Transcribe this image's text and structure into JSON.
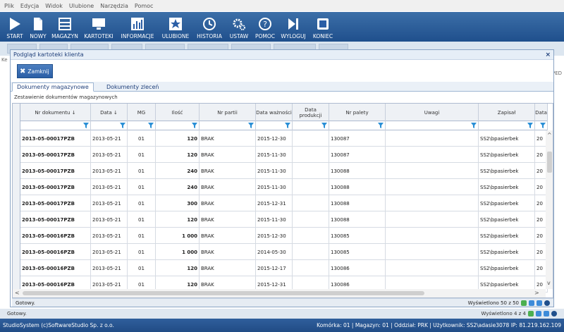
{
  "menu": [
    "Plik",
    "Edycja",
    "Widok",
    "Ulubione",
    "Narzędzia",
    "Pomoc"
  ],
  "toolbar": [
    {
      "label": "START",
      "icon": "play-icon"
    },
    {
      "label": "NOWY",
      "icon": "document-icon"
    },
    {
      "label": "MAGAZYN",
      "icon": "warehouse-icon"
    },
    {
      "label": "KARTOTEKI",
      "icon": "monitor-icon"
    },
    {
      "label": "INFORMACJE",
      "icon": "chart-icon"
    },
    {
      "label": "ULUBIONE",
      "icon": "star-icon"
    },
    {
      "label": "HISTORIA",
      "icon": "history-icon"
    },
    {
      "label": "USTAW",
      "icon": "gears-icon"
    },
    {
      "label": "POMOC",
      "icon": "help-icon"
    },
    {
      "label": "WYLOGUJ",
      "icon": "logout-icon"
    },
    {
      "label": "KONIEC",
      "icon": "window-icon"
    }
  ],
  "behind": {
    "left_label": "Ke",
    "right_label": "PED"
  },
  "dialog": {
    "title": "Podgląd kartoteki klienta",
    "close_x": "×",
    "close_button": "Zamknij",
    "tabs": [
      "Dokumenty magazynowe",
      "Dokumenty zleceń"
    ],
    "active_tab": 0,
    "section_title": "Zestawienie dokumentów magazynowych"
  },
  "grid": {
    "columns": [
      {
        "label": "Nr dokumentu ↓"
      },
      {
        "label": "Data ↓"
      },
      {
        "label": "MG"
      },
      {
        "label": "Ilość"
      },
      {
        "label": "Nr partii"
      },
      {
        "label": "Data ważności"
      },
      {
        "label": "Data produkcji"
      },
      {
        "label": "Nr palety"
      },
      {
        "label": "Uwagi"
      },
      {
        "label": "Zapisał"
      },
      {
        "label": "Data"
      }
    ],
    "rows": [
      [
        "2013-05-00017PZB",
        "2013-05-21",
        "01",
        "120",
        "BRAK",
        "2015-12-30",
        "",
        "130087",
        "",
        "SS2\\bpasierbek",
        "20"
      ],
      [
        "2013-05-00017PZB",
        "2013-05-21",
        "01",
        "120",
        "BRAK",
        "2015-11-30",
        "",
        "130087",
        "",
        "SS2\\bpasierbek",
        "20"
      ],
      [
        "2013-05-00017PZB",
        "2013-05-21",
        "01",
        "240",
        "BRAK",
        "2015-11-30",
        "",
        "130088",
        "",
        "SS2\\bpasierbek",
        "20"
      ],
      [
        "2013-05-00017PZB",
        "2013-05-21",
        "01",
        "240",
        "BRAK",
        "2015-11-30",
        "",
        "130088",
        "",
        "SS2\\bpasierbek",
        "20"
      ],
      [
        "2013-05-00017PZB",
        "2013-05-21",
        "01",
        "300",
        "BRAK",
        "2015-12-31",
        "",
        "130088",
        "",
        "SS2\\bpasierbek",
        "20"
      ],
      [
        "2013-05-00017PZB",
        "2013-05-21",
        "01",
        "120",
        "BRAK",
        "2015-11-30",
        "",
        "130088",
        "",
        "SS2\\bpasierbek",
        "20"
      ],
      [
        "2013-05-00016PZB",
        "2013-05-21",
        "01",
        "1 000",
        "BRAK",
        "2015-12-30",
        "",
        "130085",
        "",
        "SS2\\bpasierbek",
        "20"
      ],
      [
        "2013-05-00016PZB",
        "2013-05-21",
        "01",
        "1 000",
        "BRAK",
        "2014-05-30",
        "",
        "130085",
        "",
        "SS2\\bpasierbek",
        "20"
      ],
      [
        "2013-05-00016PZB",
        "2013-05-21",
        "01",
        "120",
        "BRAK",
        "2015-12-17",
        "",
        "130086",
        "",
        "SS2\\bpasierbek",
        "20"
      ],
      [
        "2013-05-00016PZB",
        "2013-05-21",
        "01",
        "120",
        "BRAK",
        "2015-12-31",
        "",
        "130086",
        "",
        "SS2\\bpasierbek",
        "20"
      ]
    ]
  },
  "status_inner": {
    "left": "Gotowy.",
    "right": "Wyświetlono 50 z 50"
  },
  "status_outer": {
    "left": "Gotowy.",
    "right": "Wyświetlono 4 z 4"
  },
  "footer": {
    "left": "StudioSystem (c)SoftwareStudio Sp. z o.o.",
    "right": "Komórka: 01 | Magazyn: 01 | Oddział: PRK | Użytkownik: SS2\\adasie3078 IP: 81.219.162.109"
  },
  "colors": {
    "toolbar": "#2a5ea6",
    "accent": "#1f3f7a",
    "filter": "#2a8fd6"
  }
}
